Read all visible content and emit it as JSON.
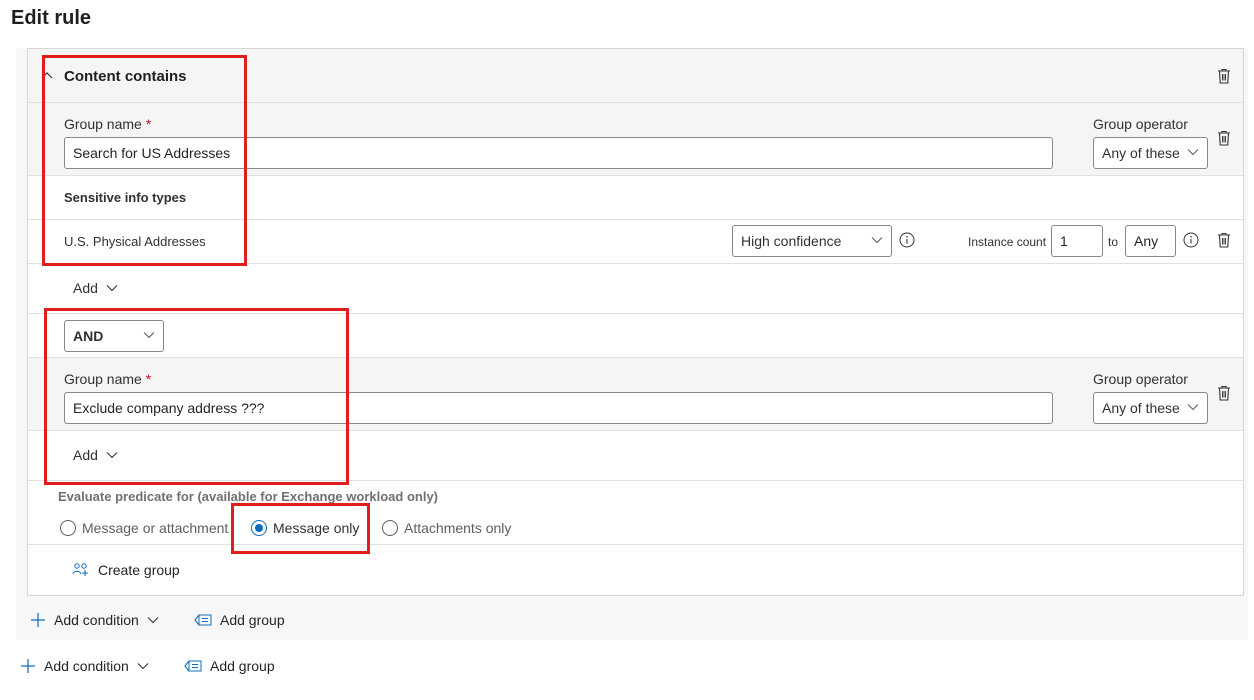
{
  "page": {
    "title": "Edit rule"
  },
  "condition": {
    "title": "Content contains",
    "group1": {
      "name_label": "Group name",
      "required_marker": "*",
      "name_value": "Search for US Addresses",
      "operator_label": "Group operator",
      "operator_value": "Any of these",
      "section_heading": "Sensitive info types",
      "item": {
        "name": "U.S. Physical Addresses",
        "confidence": "High confidence",
        "instance_label": "Instance count",
        "min": "1",
        "to_label": "to",
        "max": "Any"
      },
      "add_label": "Add"
    },
    "logic_operator": "AND",
    "group2": {
      "name_label": "Group name",
      "required_marker": "*",
      "name_value": "Exclude company address ???",
      "operator_label": "Group operator",
      "operator_value": "Any of these",
      "add_label": "Add"
    },
    "evaluate": {
      "label": "Evaluate predicate for (available for Exchange workload only)",
      "options": [
        "Message or attachment",
        "Message only",
        "Attachments only"
      ],
      "selected": "Message only"
    },
    "create_group": "Create group"
  },
  "inner_actions": {
    "add_condition": "Add condition",
    "add_group": "Add group"
  },
  "outer_actions": {
    "add_condition": "Add condition",
    "add_group": "Add group"
  },
  "colors": {
    "accent": "#0f6cbd",
    "highlight": "#e01e1e",
    "required": "#c50f1f"
  },
  "icons": [
    "chevron-up-icon",
    "trash-icon",
    "info-icon",
    "chevron-down-icon",
    "plus-icon",
    "add-group-icon",
    "create-group-icon"
  ]
}
